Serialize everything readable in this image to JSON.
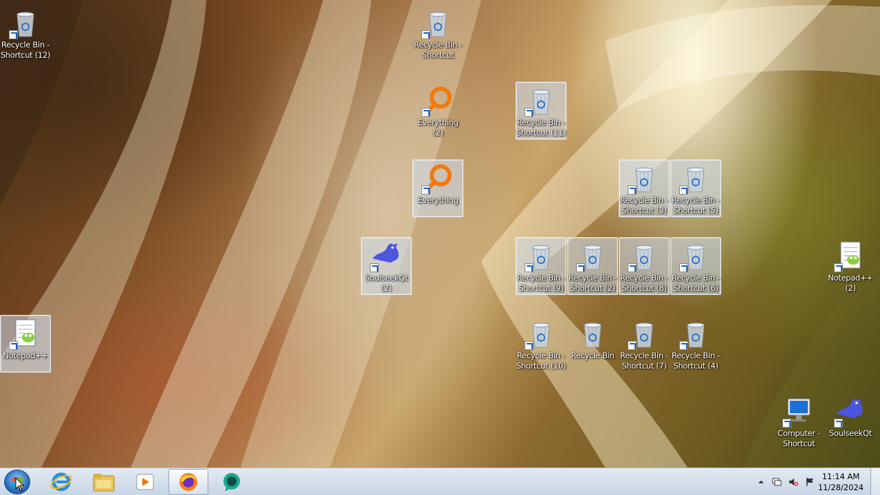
{
  "desktop_icons": [
    {
      "name": "recycle-bin-shortcut-12-icon",
      "type": "bin",
      "shortcut": true,
      "selected": false,
      "line1": "Recycle Bin -",
      "line2": "Shortcut (12)"
    },
    {
      "name": "recycle-bin-shortcut-icon",
      "type": "bin",
      "shortcut": true,
      "selected": false,
      "line1": "Recycle Bin -",
      "line2": "Shortcut"
    },
    {
      "name": "everything-2-icon",
      "type": "everything",
      "shortcut": true,
      "selected": false,
      "line1": "Everything",
      "line2": "(2)"
    },
    {
      "name": "recycle-bin-shortcut-11-icon",
      "type": "bin",
      "shortcut": true,
      "selected": true,
      "line1": "Recycle Bin -",
      "line2": "Shortcut (11)"
    },
    {
      "name": "everything-icon",
      "type": "everything",
      "shortcut": true,
      "selected": true,
      "line1": "Everything",
      "line2": ""
    },
    {
      "name": "recycle-bin-shortcut-3-icon",
      "type": "bin",
      "shortcut": true,
      "selected": true,
      "line1": "Recycle Bin -",
      "line2": "Shortcut (3)"
    },
    {
      "name": "recycle-bin-shortcut-5-icon",
      "type": "bin",
      "shortcut": true,
      "selected": true,
      "line1": "Recycle Bin -",
      "line2": "Shortcut (5)"
    },
    {
      "name": "soulseekqt-2-icon",
      "type": "soulseek",
      "shortcut": true,
      "selected": true,
      "line1": "SoulseekQt",
      "line2": "(2)"
    },
    {
      "name": "recycle-bin-shortcut-9-icon",
      "type": "bin",
      "shortcut": true,
      "selected": true,
      "line1": "Recycle Bin -",
      "line2": "Shortcut (9)"
    },
    {
      "name": "recycle-bin-shortcut-2-icon",
      "type": "bin",
      "shortcut": true,
      "selected": true,
      "line1": "Recycle Bin -",
      "line2": "Shortcut (2)"
    },
    {
      "name": "recycle-bin-shortcut-8-icon",
      "type": "bin",
      "shortcut": true,
      "selected": true,
      "line1": "Recycle Bin -",
      "line2": "Shortcut (8)"
    },
    {
      "name": "recycle-bin-shortcut-6-icon",
      "type": "bin",
      "shortcut": true,
      "selected": true,
      "line1": "Recycle Bin -",
      "line2": "Shortcut (6)"
    },
    {
      "name": "notepadpp-2-icon",
      "type": "notepad",
      "shortcut": true,
      "selected": false,
      "line1": "Notepad++",
      "line2": "(2)"
    },
    {
      "name": "notepadpp-icon",
      "type": "notepad",
      "shortcut": true,
      "selected": true,
      "line1": "Notepad++",
      "line2": ""
    },
    {
      "name": "recycle-bin-shortcut-10-icon",
      "type": "bin",
      "shortcut": true,
      "selected": false,
      "line1": "Recycle Bin -",
      "line2": "Shortcut (10)"
    },
    {
      "name": "recycle-bin-icon",
      "type": "bin",
      "shortcut": false,
      "selected": false,
      "line1": "Recycle Bin",
      "line2": ""
    },
    {
      "name": "recycle-bin-shortcut-7-icon",
      "type": "bin",
      "shortcut": true,
      "selected": false,
      "line1": "Recycle Bin -",
      "line2": "Shortcut (7)"
    },
    {
      "name": "recycle-bin-shortcut-4-icon",
      "type": "bin",
      "shortcut": true,
      "selected": false,
      "line1": "Recycle Bin -",
      "line2": "Shortcut (4)"
    },
    {
      "name": "computer-shortcut-icon",
      "type": "computer",
      "shortcut": true,
      "selected": false,
      "line1": "Computer -",
      "line2": "Shortcut"
    },
    {
      "name": "soulseekqt-icon",
      "type": "soulseek",
      "shortcut": true,
      "selected": false,
      "line1": "SoulseekQt",
      "line2": ""
    }
  ],
  "taskbar": {
    "pinned": [
      {
        "name": "internet-explorer-icon",
        "active": false
      },
      {
        "name": "file-explorer-icon",
        "active": false
      },
      {
        "name": "media-player-icon",
        "active": false
      },
      {
        "name": "firefox-icon",
        "active": true
      },
      {
        "name": "chat-app-icon",
        "active": false
      }
    ],
    "clock": {
      "time": "11:14 AM",
      "date": "11/28/2024"
    }
  },
  "colors": {
    "selection": "#cddcf0",
    "taskbar_top": "#e1e8f2",
    "taskbar_bottom": "#c4d2e4",
    "icon_label": "#ffffff"
  }
}
